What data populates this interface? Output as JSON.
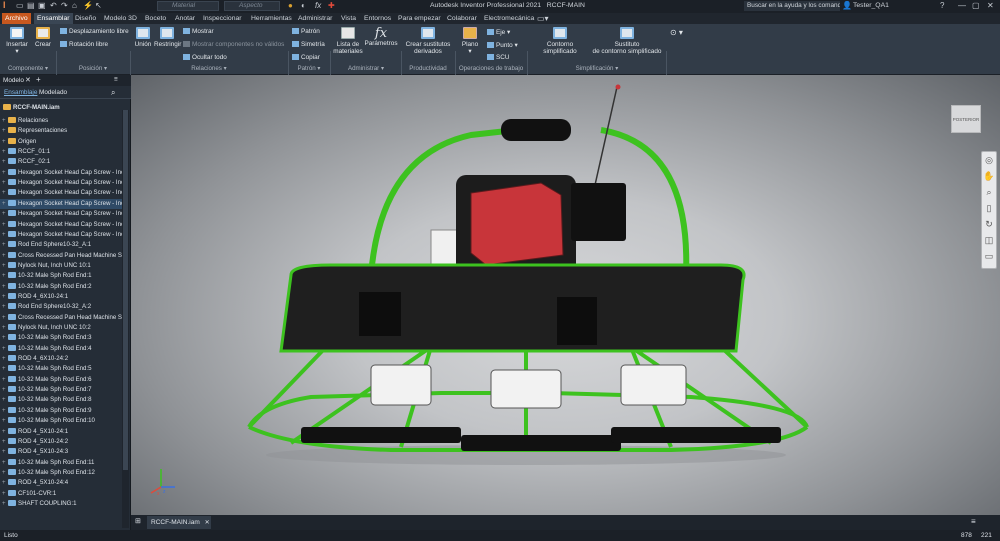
{
  "title": {
    "app": "Autodesk Inventor Professional 2021",
    "document": "RCCF-MAIN",
    "search_placeholder": "Buscar en la ayuda y los comandos",
    "user": "Tester_QA1",
    "material_placeholder": "Material",
    "appearance_placeholder": "Aspecto"
  },
  "tabs": [
    "Archivo",
    "Ensamblar",
    "Diseño",
    "Modelo 3D",
    "Boceto",
    "Anotar",
    "Inspeccionar",
    "Herramientas",
    "Administrar",
    "Vista",
    "Entornos",
    "Para empezar",
    "Colaborar",
    "Electromecánica"
  ],
  "ribbon": {
    "componente": {
      "insertar": "Insertar",
      "crear": "Crear",
      "label": "Componente"
    },
    "posicion": {
      "desplazamiento": "Desplazamiento libre",
      "rotacion": "Rotación libre",
      "label": "Posición"
    },
    "relaciones": {
      "union": "Unión",
      "restringir": "Restringir",
      "mostrar": "Mostrar",
      "mostrar_comp": "Mostrar componentes no válidos",
      "ocultar": "Ocultar todo",
      "label": "Relaciones"
    },
    "patron": {
      "patron": "Patrón",
      "simetria": "Simetría",
      "copiar": "Copiar",
      "label": "Patrón"
    },
    "administrar": {
      "lista1": "Lista de",
      "lista2": "materiales",
      "parametros": "Parámetros",
      "label": "Administrar"
    },
    "productividad": {
      "crear1": "Crear sustitutos",
      "crear2": "derivados",
      "label": "Productividad"
    },
    "operaciones": {
      "plano": "Plano",
      "eje": "Eje",
      "punto": "Punto",
      "scu": "SCU",
      "label": "Operaciones de trabajo"
    },
    "simplificacion": {
      "contorno": "Contorno simplificado",
      "sust1": "Sustituto",
      "sust2": "de contorno simplificado",
      "label": "Simplificación"
    }
  },
  "browser": {
    "panel_title": "Modelo",
    "tab_ensamblaje": "Ensamblaje",
    "tab_modelado": "Modelado",
    "root": "RCCF-MAIN.iam",
    "items": [
      {
        "label": "Relaciones",
        "type": "folder"
      },
      {
        "label": "Representaciones",
        "type": "folder"
      },
      {
        "label": "Origen",
        "type": "folder"
      },
      {
        "label": "RCCF_01:1",
        "type": "part"
      },
      {
        "label": "RCCF_02:1",
        "type": "part"
      },
      {
        "label": "Hexagon Socket Head Cap Screw - Inch",
        "type": "screw"
      },
      {
        "label": "Hexagon Socket Head Cap Screw - Inch",
        "type": "screw"
      },
      {
        "label": "Hexagon Socket Head Cap Screw - Inch",
        "type": "screw"
      },
      {
        "label": "Hexagon Socket Head Cap Screw - Inch",
        "type": "screw",
        "selected": true
      },
      {
        "label": "Hexagon Socket Head Cap Screw - Inch",
        "type": "screw"
      },
      {
        "label": "Hexagon Socket Head Cap Screw - Inch",
        "type": "screw"
      },
      {
        "label": "Hexagon Socket Head Cap Screw - Inch",
        "type": "screw"
      },
      {
        "label": "Rod End Sphere10-32_A:1",
        "type": "part"
      },
      {
        "label": "Cross Recessed Pan Head Machine Screw",
        "type": "screw"
      },
      {
        "label": "Nylock Nut, Inch UNC 10:1",
        "type": "screw"
      },
      {
        "label": "10-32 Male Sph Rod End:1",
        "type": "part"
      },
      {
        "label": "10-32 Male Sph Rod End:2",
        "type": "part"
      },
      {
        "label": "ROD 4_6X10-24:1",
        "type": "part"
      },
      {
        "label": "Rod End Sphere10-32_A:2",
        "type": "part"
      },
      {
        "label": "Cross Recessed Pan Head Machine Screw",
        "type": "screw"
      },
      {
        "label": "Nylock Nut, Inch UNC 10:2",
        "type": "screw"
      },
      {
        "label": "10-32 Male Sph Rod End:3",
        "type": "part"
      },
      {
        "label": "10-32 Male Sph Rod End:4",
        "type": "part"
      },
      {
        "label": "ROD 4_6X10-24:2",
        "type": "part"
      },
      {
        "label": "10-32 Male Sph Rod End:5",
        "type": "part"
      },
      {
        "label": "10-32 Male Sph Rod End:6",
        "type": "part"
      },
      {
        "label": "10-32 Male Sph Rod End:7",
        "type": "part"
      },
      {
        "label": "10-32 Male Sph Rod End:8",
        "type": "part"
      },
      {
        "label": "10-32 Male Sph Rod End:9",
        "type": "part"
      },
      {
        "label": "10-32 Male Sph Rod End:10",
        "type": "part"
      },
      {
        "label": "ROD 4_5X10-24:1",
        "type": "part"
      },
      {
        "label": "ROD 4_5X10-24:2",
        "type": "part"
      },
      {
        "label": "ROD 4_5X10-24:3",
        "type": "part"
      },
      {
        "label": "10-32 Male Sph Rod End:11",
        "type": "part"
      },
      {
        "label": "10-32 Male Sph Rod End:12",
        "type": "part"
      },
      {
        "label": "ROD 4_5X10-24:4",
        "type": "part"
      },
      {
        "label": "CF101-CVR:1",
        "type": "part"
      },
      {
        "label": "SHAFT COUPLING:1",
        "type": "part"
      }
    ]
  },
  "viewcube_face": "POSTERIOR",
  "doc_tab": "RCCF-MAIN.iam",
  "status": {
    "text": "Listo",
    "count1": "878",
    "count2": "221"
  },
  "colors": {
    "accent": "#c7581f",
    "ribbon": "#323c48",
    "frame_green": "#3dc21f",
    "engine_red": "#c8353a"
  }
}
